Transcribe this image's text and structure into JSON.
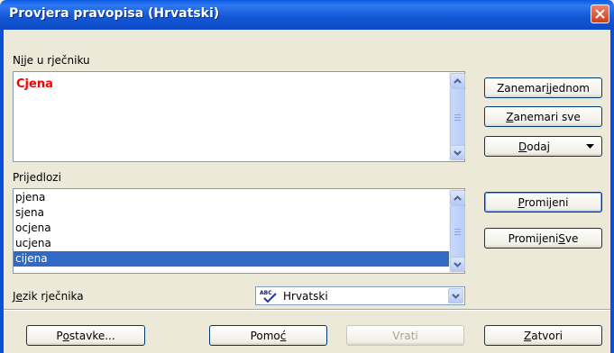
{
  "window": {
    "title": "Provjera pravopisa (Hrvatski)"
  },
  "not_in_dictionary": {
    "label_prefix": "N",
    "label_underlined": "i",
    "label_rest": "je u rječniku",
    "text": "Cjena"
  },
  "suggestions": {
    "label": "Prijedlozi",
    "items": [
      "pjena",
      "sjena",
      "ocjena",
      "ucjena",
      "cijena"
    ],
    "selected_index": 4
  },
  "language": {
    "label_prefix": "J",
    "label_underlined": "e",
    "label_rest": "zik rječnika",
    "value": "Hrvatski"
  },
  "buttons": {
    "ignore_once_pre": "Zanemar",
    "ignore_once_u": "i",
    "ignore_once_post": " jednom",
    "ignore_all_u": "Z",
    "ignore_all_post": "anemari sve",
    "add_u": "D",
    "add_post": "odaj",
    "change_u": "P",
    "change_post": "romijeni",
    "change_all_pre": "Promijeni ",
    "change_all_u": "S",
    "change_all_post": "ve",
    "options_pre": "P",
    "options_u": "o",
    "options_post": "stavke...",
    "help_pre": "Pomo",
    "help_u": "ć",
    "help_post": "",
    "undo": "Vrati",
    "close_u": "Z",
    "close_post": "atvori"
  },
  "colors": {
    "error_text": "#ff0000",
    "selection": "#316ac5"
  }
}
